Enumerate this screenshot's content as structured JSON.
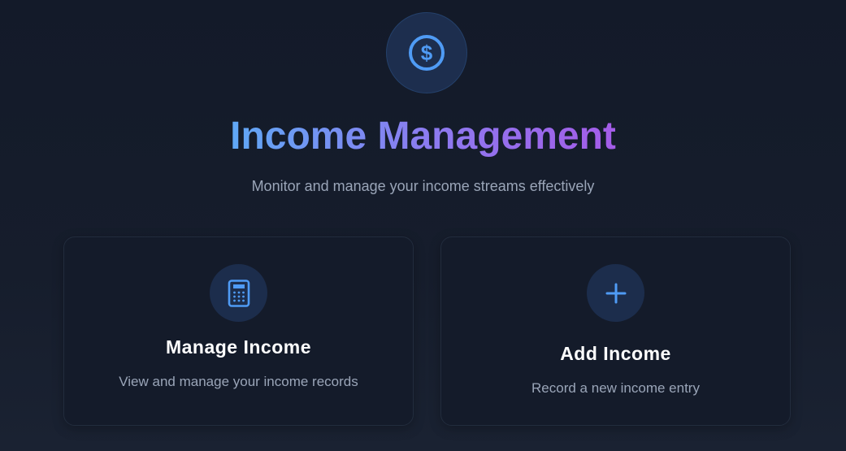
{
  "header": {
    "icon": "dollar-circle-icon",
    "title": "Income Management",
    "subtitle": "Monitor and manage your income streams effectively"
  },
  "cards": [
    {
      "icon": "calculator-icon",
      "title": "Manage Income",
      "description": "View and manage your income records"
    },
    {
      "icon": "plus-icon",
      "title": "Add Income",
      "description": "Record a new income entry"
    }
  ],
  "colors": {
    "background": "#151c2b",
    "card_background": "#141b2a",
    "icon_accent": "#4f9bf5",
    "title_gradient_start": "#5fa8f5",
    "title_gradient_end": "#a45ce8",
    "muted_text": "#9aa5b8"
  }
}
